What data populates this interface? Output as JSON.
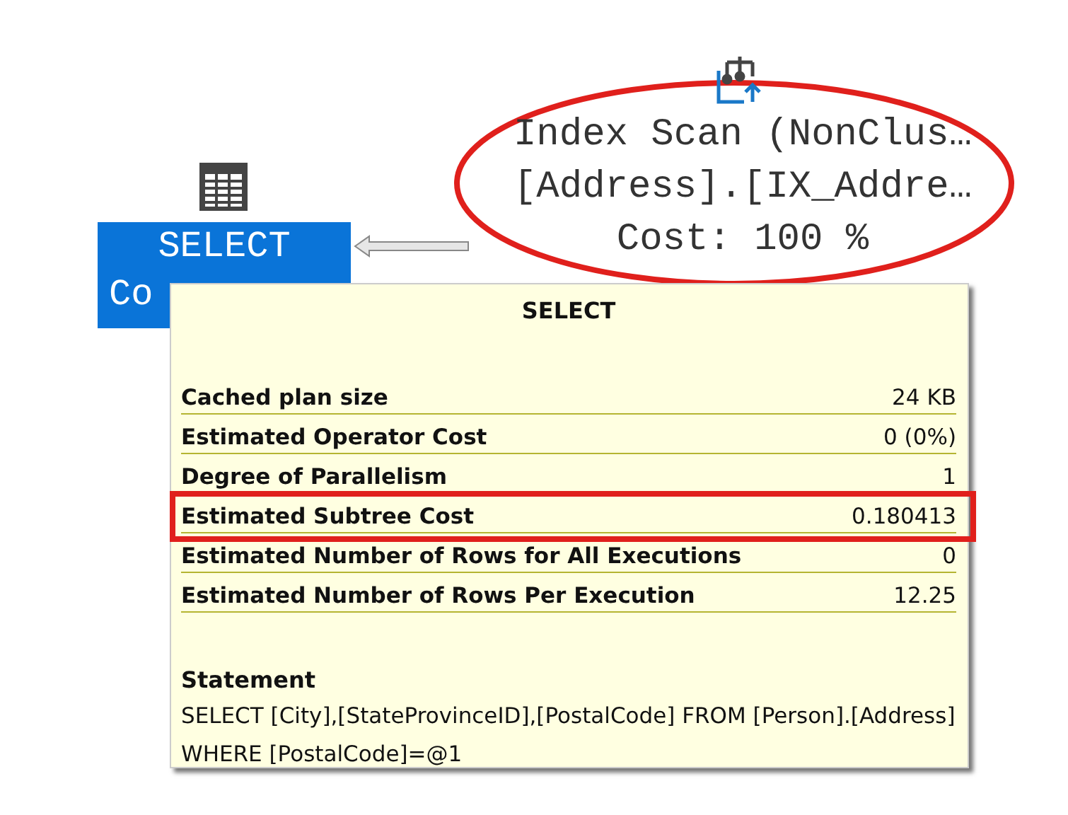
{
  "nodes": [
    {
      "kind": "select",
      "selected": true,
      "lines": [
        "SELECT",
        "Co"
      ]
    },
    {
      "kind": "index_scan",
      "selected": false,
      "lines": [
        "Index Scan (NonClus…",
        "[Address].[IX_Addre…",
        "Cost: 100 %"
      ]
    }
  ],
  "tooltip": {
    "title": "SELECT",
    "rows": [
      {
        "label": "Cached plan size",
        "value": "24 KB",
        "highlighted": false
      },
      {
        "label": "Estimated Operator Cost",
        "value": "0 (0%)",
        "highlighted": false
      },
      {
        "label": "Degree of Parallelism",
        "value": "1",
        "highlighted": false
      },
      {
        "label": "Estimated Subtree Cost",
        "value": "0.180413",
        "highlighted": true
      },
      {
        "label": "Estimated Number of Rows for All Executions",
        "value": "0",
        "highlighted": false
      },
      {
        "label": "Estimated Number of Rows Per Execution",
        "value": "12.25",
        "highlighted": false
      }
    ],
    "statement_heading": "Statement",
    "statement": "SELECT [City],[StateProvinceID],[PostalCode] FROM [Person].[Address] WHERE [PostalCode]=@1"
  }
}
